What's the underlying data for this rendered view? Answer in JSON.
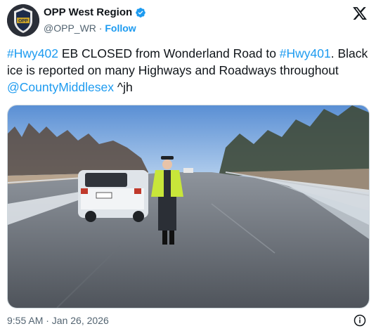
{
  "account": {
    "display_name": "OPP West Region",
    "handle": "@OPP_WR",
    "separator": " · ",
    "follow_label": "Follow",
    "avatar_text": "OPP"
  },
  "tweet": {
    "parts": [
      {
        "text": "#Hwy402",
        "link": true
      },
      {
        "text": " EB CLOSED from Wonderland Road to ",
        "link": false
      },
      {
        "text": "#Hwy401",
        "link": true
      },
      {
        "text": ". Black ice is reported on many Highways and Roadways throughout ",
        "link": false
      },
      {
        "text": "@CountyMiddlesex",
        "link": true
      },
      {
        "text": " ^jh",
        "link": false
      }
    ]
  },
  "timestamp": "9:55 AM · Jan 26, 2026",
  "icons": {
    "verified": "verified-badge-icon",
    "platform": "x-logo-icon",
    "info": "info-icon"
  },
  "colors": {
    "link": "#1d9bf0",
    "secondary_text": "#536471",
    "primary_text": "#0f1419"
  }
}
